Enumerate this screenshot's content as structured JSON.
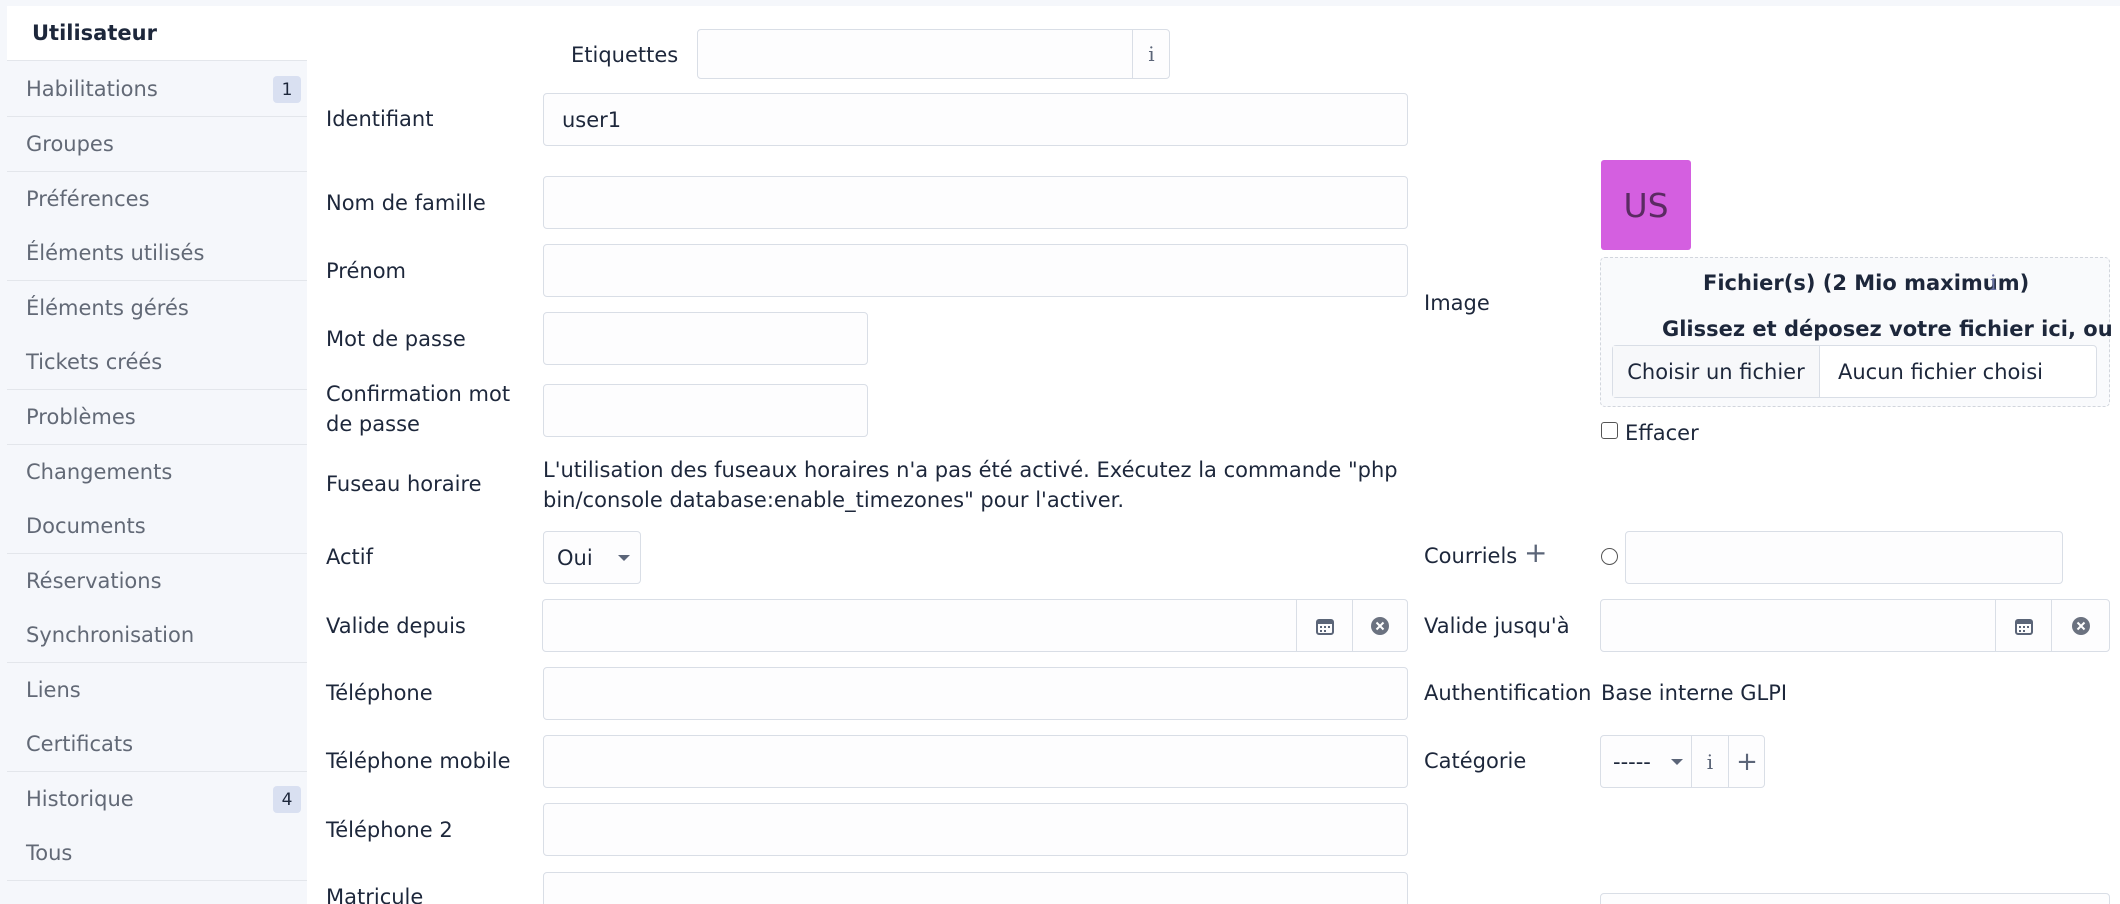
{
  "sidebar": {
    "items": [
      {
        "label": "Utilisateur",
        "active": true
      },
      {
        "label": "Habilitations",
        "badge": "1"
      },
      {
        "label": "Groupes"
      },
      {
        "label": "Préférences"
      },
      {
        "label": "Éléments utilisés"
      },
      {
        "label": "Éléments gérés"
      },
      {
        "label": "Tickets créés"
      },
      {
        "label": "Problèmes"
      },
      {
        "label": "Changements"
      },
      {
        "label": "Documents"
      },
      {
        "label": "Réservations"
      },
      {
        "label": "Synchronisation"
      },
      {
        "label": "Liens"
      },
      {
        "label": "Certificats"
      },
      {
        "label": "Historique",
        "badge": "4"
      },
      {
        "label": "Tous"
      }
    ]
  },
  "form": {
    "etiquettes_label": "Etiquettes",
    "identifiant_label": "Identifiant",
    "identifiant_value": "user1",
    "nom_label": "Nom de famille",
    "prenom_label": "Prénom",
    "password_label": "Mot de passe",
    "password_confirm_label_1": "Confirmation mot",
    "password_confirm_label_2": "de passe",
    "timezone_label": "Fuseau horaire",
    "timezone_msg_1": "L'utilisation des fuseaux horaires n'a pas été activé. Exécutez la commande \"php",
    "timezone_msg_2": "bin/console database:enable_timezones\" pour l'activer.",
    "actif_label": "Actif",
    "actif_value": "Oui",
    "valid_from_label": "Valide depuis",
    "phone_label": "Téléphone",
    "mobile_label": "Téléphone mobile",
    "phone2_label": "Téléphone 2",
    "matricule_label": "Matricule",
    "image_label": "Image",
    "avatar_initials": "US",
    "upload_title": "Fichier(s) (2 Mio maximum)",
    "upload_hint": "Glissez et déposez votre fichier ici, ou",
    "choose_file": "Choisir un fichier",
    "no_file": "Aucun fichier choisi",
    "clear_label": "Effacer",
    "emails_label": "Courriels",
    "valid_until_label": "Valide jusqu'à",
    "auth_label": "Authentification",
    "auth_value": "Base interne GLPI",
    "category_label": "Catégorie",
    "category_value": "-----"
  },
  "colors": {
    "avatar_bg": "#d45fe0",
    "badge_bg": "#d9e0f1"
  }
}
